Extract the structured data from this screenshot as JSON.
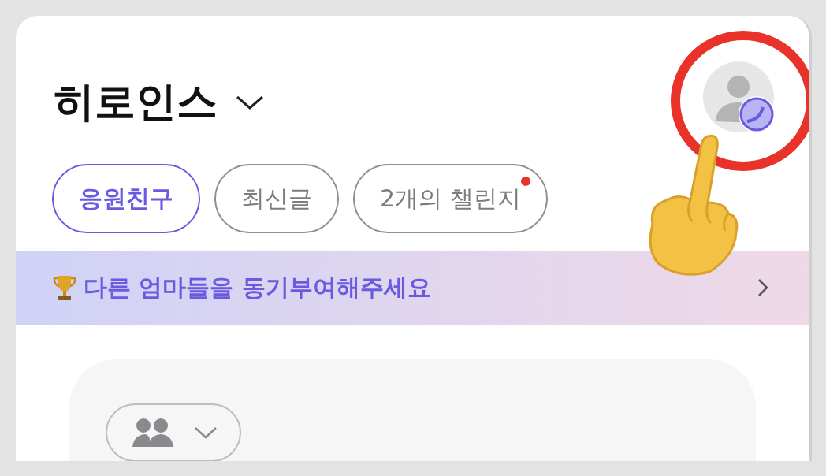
{
  "header": {
    "title": "히로인스"
  },
  "tabs": [
    {
      "label": "응원친구",
      "selected": true,
      "badge": false
    },
    {
      "label": "최신글",
      "selected": false,
      "badge": false
    },
    {
      "label": "2개의 챌린지",
      "selected": false,
      "badge": true
    }
  ],
  "banner": {
    "text": "다른 엄마들을 동기부여해주세요"
  },
  "annotation": {
    "highlight": true
  }
}
